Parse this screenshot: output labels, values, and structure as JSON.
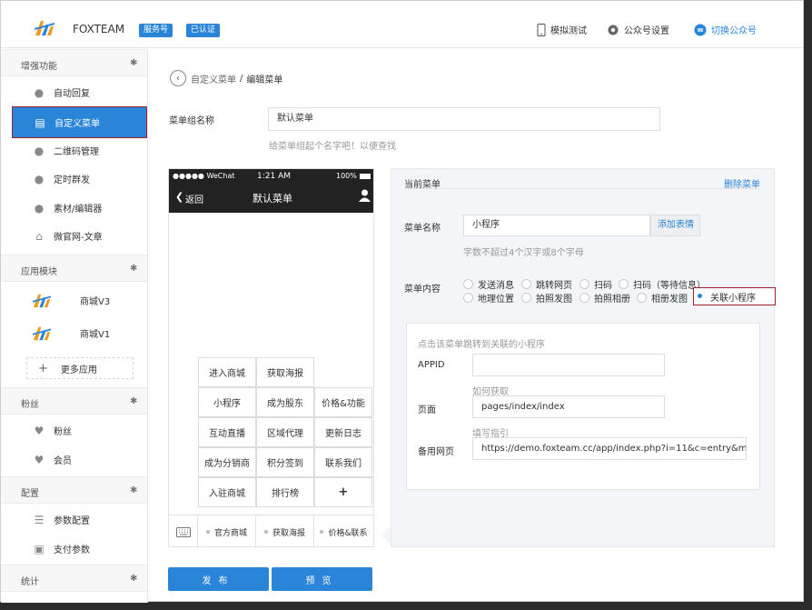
{
  "header": {
    "brand": "FOXTEAM",
    "badge_service": "服务号",
    "badge_verified": "已认证",
    "nav_test": "模拟测试",
    "nav_settings": "公众号设置",
    "nav_switch": "切换公众号"
  },
  "sidebar": {
    "section_enhance": "增强功能",
    "items_enhance": [
      "自动回复",
      "自定义菜单",
      "二维码管理",
      "定时群发",
      "素材/编辑器",
      "微官网-文章"
    ],
    "section_apps": "应用模块",
    "apps": [
      "商城V3",
      "商城V1"
    ],
    "more_apps": "更多应用",
    "section_fans": "粉丝",
    "items_fans": [
      "粉丝",
      "会员"
    ],
    "section_config": "配置",
    "items_config": [
      "参数配置",
      "支付参数"
    ],
    "section_stats": "统计"
  },
  "breadcrumb": {
    "parent": "自定义菜单",
    "sep": "/",
    "current": "编辑菜单"
  },
  "menu_group": {
    "label": "菜单组名称",
    "value": "默认菜单",
    "hint": "给菜单组起个名字吧！以便查找"
  },
  "phone": {
    "carrier": "●●●●● WeChat",
    "time": "1:21 AM",
    "battery": "100%",
    "back": "返回",
    "title": "默认菜单",
    "grid": [
      [
        "进入商城",
        "获取海报",
        ""
      ],
      [
        "小程序",
        "成为股东",
        "价格&功能"
      ],
      [
        "互动直播",
        "区域代理",
        "更新日志"
      ],
      [
        "成为分销商",
        "积分签到",
        "联系我们"
      ],
      [
        "入驻商城",
        "排行榜",
        "+"
      ]
    ],
    "tabs": [
      "官方商城",
      "获取海报",
      "价格&联系"
    ]
  },
  "panel": {
    "title": "当前菜单",
    "delete": "删除菜单",
    "name_label": "菜单名称",
    "name_value": "小程序",
    "emoji_btn": "添加表情",
    "name_hint": "字数不超过4个汉字或8个字母",
    "content_label": "菜单内容",
    "options_row1": [
      "发送消息",
      "跳转网页",
      "扫码",
      "扫码（等待信息）"
    ],
    "options_row2": [
      "地理位置",
      "拍照发图",
      "拍照相册",
      "相册发图",
      "关联小程序"
    ],
    "selected": "关联小程序",
    "sub_hint": "点击该菜单跳转到关联的小程序",
    "appid_label": "APPID",
    "appid_value": "",
    "how_get": "如何获取",
    "page_label": "页面",
    "page_value": "pages/index/index",
    "guide": "填写指引",
    "backup_label": "备用网页",
    "backup_value": "https://demo.foxteam.cc/app/index.php?i=11&c=entry&m"
  },
  "buttons": {
    "publish": "发布",
    "preview": "预览"
  },
  "colors": {
    "accent": "#2a84d8",
    "highlight_border": "#a01f2a"
  }
}
